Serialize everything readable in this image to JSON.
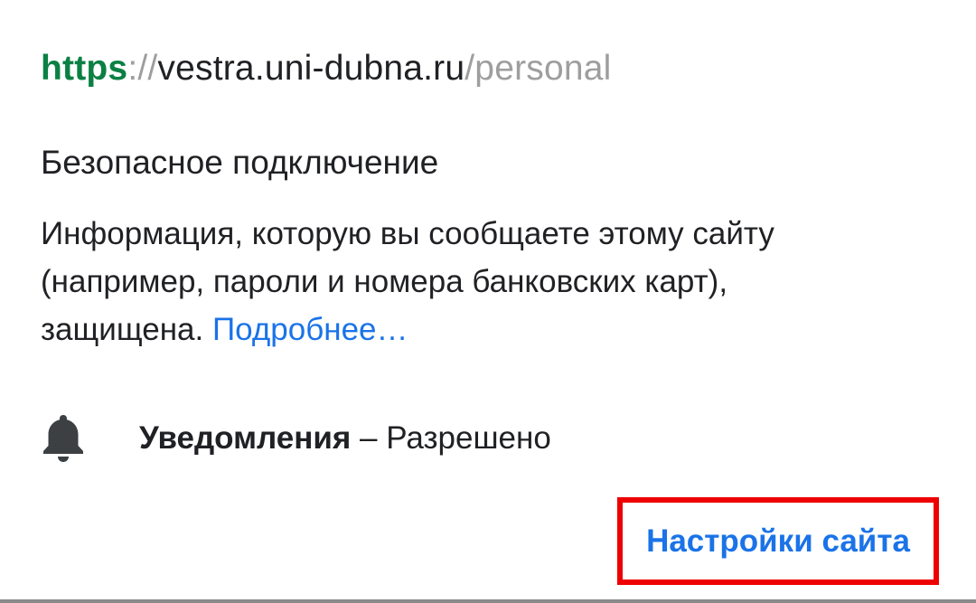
{
  "url": {
    "scheme": "https",
    "separator": "://",
    "host": "vestra.uni-dubna.ru",
    "path": "/personal"
  },
  "connection": {
    "title": "Безопасное подключение",
    "description_lines": [
      "Информация, которую вы сообщаете этому сайту",
      "(например, пароли и номера банковских карт),",
      "защищена."
    ],
    "learn_more": "Подробнее…"
  },
  "permissions": [
    {
      "icon": "bell-icon",
      "name": "Уведомления",
      "separator": "–",
      "status": "Разрешено"
    }
  ],
  "footer": {
    "site_settings_label": "Настройки сайта"
  },
  "colors": {
    "scheme": "#0b8043",
    "link": "#1a73e8",
    "highlight": "#ee0000"
  }
}
